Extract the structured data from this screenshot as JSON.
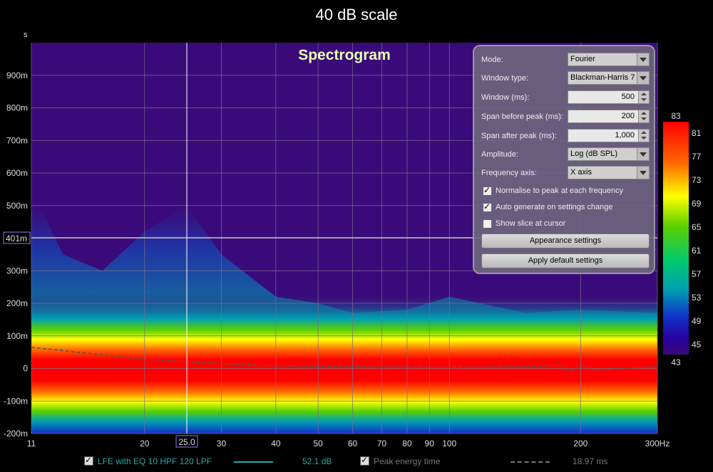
{
  "title": "40 dB scale",
  "chart_data": {
    "type": "heatmap",
    "title": "Spectrogram",
    "x_axis": {
      "scale": "log",
      "range": [
        11,
        300
      ],
      "unit": "Hz",
      "ticks": [
        "11",
        "20",
        "25.0",
        "30",
        "40",
        "50",
        "60",
        "70",
        "80",
        "90",
        "100",
        "200",
        "300Hz"
      ],
      "tick_values": [
        11,
        20,
        25,
        30,
        40,
        50,
        60,
        70,
        80,
        90,
        100,
        200,
        300
      ]
    },
    "y_axis": {
      "unit": "s",
      "range": [
        -0.2,
        1.0
      ],
      "ticks": [
        "-200m",
        "-100m",
        "0",
        "100m",
        "200m",
        "300m",
        "400m",
        "500m",
        "600m",
        "700m",
        "800m",
        "900m"
      ],
      "tick_values": [
        -0.2,
        -0.1,
        0,
        0.1,
        0.2,
        0.3,
        0.4,
        0.5,
        0.6,
        0.7,
        0.8,
        0.9
      ]
    },
    "cursor": {
      "x_label": "25.0",
      "y_label": "401m",
      "x": 25,
      "y": 0.401
    },
    "colorbar": {
      "min_label": "43",
      "max_label": "83",
      "ticks": [
        "81",
        "77",
        "73",
        "69",
        "65",
        "61",
        "57",
        "53",
        "49",
        "45"
      ]
    },
    "series": [
      {
        "name": "LFE with EQ 10 HPF 120 LPF",
        "value_label": "52.1 dB"
      },
      {
        "name": "Peak energy time",
        "value_label": "18.97 ms"
      }
    ]
  },
  "panel": {
    "mode_label": "Mode:",
    "mode_value": "Fourier",
    "window_type_label": "Window type:",
    "window_type_value": "Blackman-Harris 7",
    "window_ms_label": "Window (ms):",
    "window_ms_value": "500",
    "span_before_label": "Span before peak (ms):",
    "span_before_value": "200",
    "span_after_label": "Span after peak (ms):",
    "span_after_value": "1,000",
    "amplitude_label": "Amplitude:",
    "amplitude_value": "Log (dB SPL)",
    "freq_axis_label": "Frequency axis:",
    "freq_axis_value": "X axis",
    "normalise_label": "Normalise to peak at each frequency",
    "autogen_label": "Auto generate on settings change",
    "slice_label": "Show slice at cursor",
    "appearance_button": "Appearance settings",
    "defaults_button": "Apply default settings"
  },
  "colors": {
    "background": "#000000",
    "plot_bg": "#3a0a7a",
    "grid": "#7a6e8a"
  }
}
